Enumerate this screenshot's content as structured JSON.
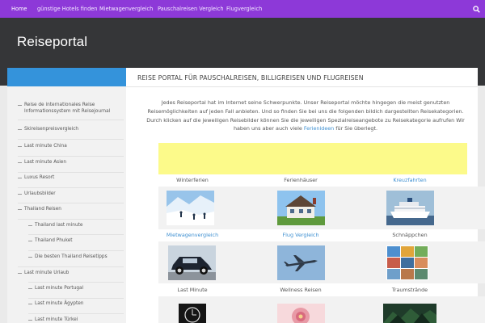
{
  "topnav": {
    "items": [
      {
        "label": "Home",
        "active": true
      },
      {
        "label": "günstige Hotels finden"
      },
      {
        "label": "Mietwagenvergleich"
      },
      {
        "label": "Pauschalreisen Vergleich"
      },
      {
        "label": "Flugvergleich"
      }
    ],
    "search_icon": "search-icon",
    "background": "#8d39d8"
  },
  "header": {
    "site_title": "Reiseportal",
    "background": "#353638"
  },
  "sidebar": {
    "accent": "#3493db",
    "items": [
      {
        "label": "Reise de internationales Reise Informationssystem mit Reisejournal"
      },
      {
        "label": "Skireisenpreisvergleich"
      },
      {
        "label": "Last minute China"
      },
      {
        "label": "Last minute Asien"
      },
      {
        "label": "Luxus Resort"
      },
      {
        "label": "Urlaubsbilder"
      },
      {
        "label": "Thailand Reisen"
      },
      {
        "label": "Thailand last minute"
      },
      {
        "label": "Thailand Phuket"
      },
      {
        "label": "Die besten Thailand Reisetipps"
      },
      {
        "label": "Last minute Urlaub"
      },
      {
        "label": "Last minute Portugal"
      },
      {
        "label": "Last minute Ägypten"
      },
      {
        "label": "Last minute Türkei"
      }
    ]
  },
  "main": {
    "title": "Reise Portal für Pauschalreisen, Billigreisen und Flugreisen",
    "intro_text": "Jedes Reiseportal hat im Internet seine Schwerpunkte. Unser Reiseportal möchte hingegen die meist genutzten Reisemöglichkeiten auf jeden Fall anbieten. Und so finden Sie bei uns die folgenden bildich dargestellten Reisekategorien. Durch klicken auf die jeweiligen Reisebilder können Sie die jeweiligen Spezialreiseangebote zu Reisekategorie aufrufen Wir haben uns aber auch viele",
    "intro_link": "Ferienideen",
    "intro_tail": "für Sie überlegt.",
    "ad_color": "#fcfa8a",
    "link_color": "#3d8fd1",
    "grid": [
      {
        "label": "Winterferien",
        "link": false,
        "image": "winter-skiing-photo"
      },
      {
        "label": "Ferienhäuser",
        "link": false,
        "image": "holiday-house-photo"
      },
      {
        "label": "Kreuzfahrten",
        "link": true,
        "image": "cruise-ship-photo"
      },
      {
        "label": "Mietwagenvergleich",
        "link": true,
        "image": "vintage-car-photo"
      },
      {
        "label": "Flug Vergleich",
        "link": true,
        "image": "airplane-photo"
      },
      {
        "label": "Schnäppchen",
        "link": false,
        "image": "bargain-collage-photo"
      },
      {
        "label": "Last Minute",
        "link": false,
        "image": "last-minute-photo"
      },
      {
        "label": "Wellness Reisen",
        "link": false,
        "image": "wellness-flower-photo"
      },
      {
        "label": "Traumstrände",
        "link": false,
        "image": "dream-beach-photo"
      }
    ]
  }
}
